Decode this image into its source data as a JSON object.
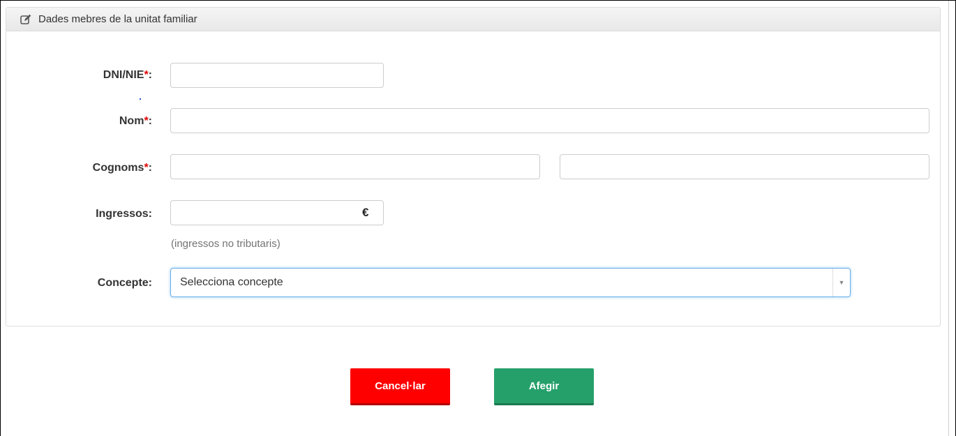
{
  "panel": {
    "title": "Dades mebres de la unitat familiar",
    "icon": "edit-icon"
  },
  "form": {
    "dni": {
      "label": "DNI/NIE",
      "required_mark": "*",
      "suffix": ":",
      "value": ""
    },
    "nom": {
      "label": "Nom",
      "required_mark": "*",
      "suffix": ":",
      "value": ""
    },
    "cognoms": {
      "label": "Cognoms",
      "required_mark": "*",
      "suffix": ":",
      "value_first": "",
      "value_second": ""
    },
    "ingressos": {
      "label": "Ingressos:",
      "value": "",
      "currency": "€",
      "help": "(ingressos no tributaris)"
    },
    "concepte": {
      "label": "Concepte:",
      "selected": "Selecciona concepte",
      "arrow_icon": "caret-down-icon"
    }
  },
  "buttons": {
    "cancel": "Cancel·lar",
    "add": "Afegir"
  },
  "colors": {
    "required": "#e00000",
    "cancel_bg": "#ff0000",
    "add_bg": "#26a06b",
    "focus_border": "#66afe9"
  }
}
